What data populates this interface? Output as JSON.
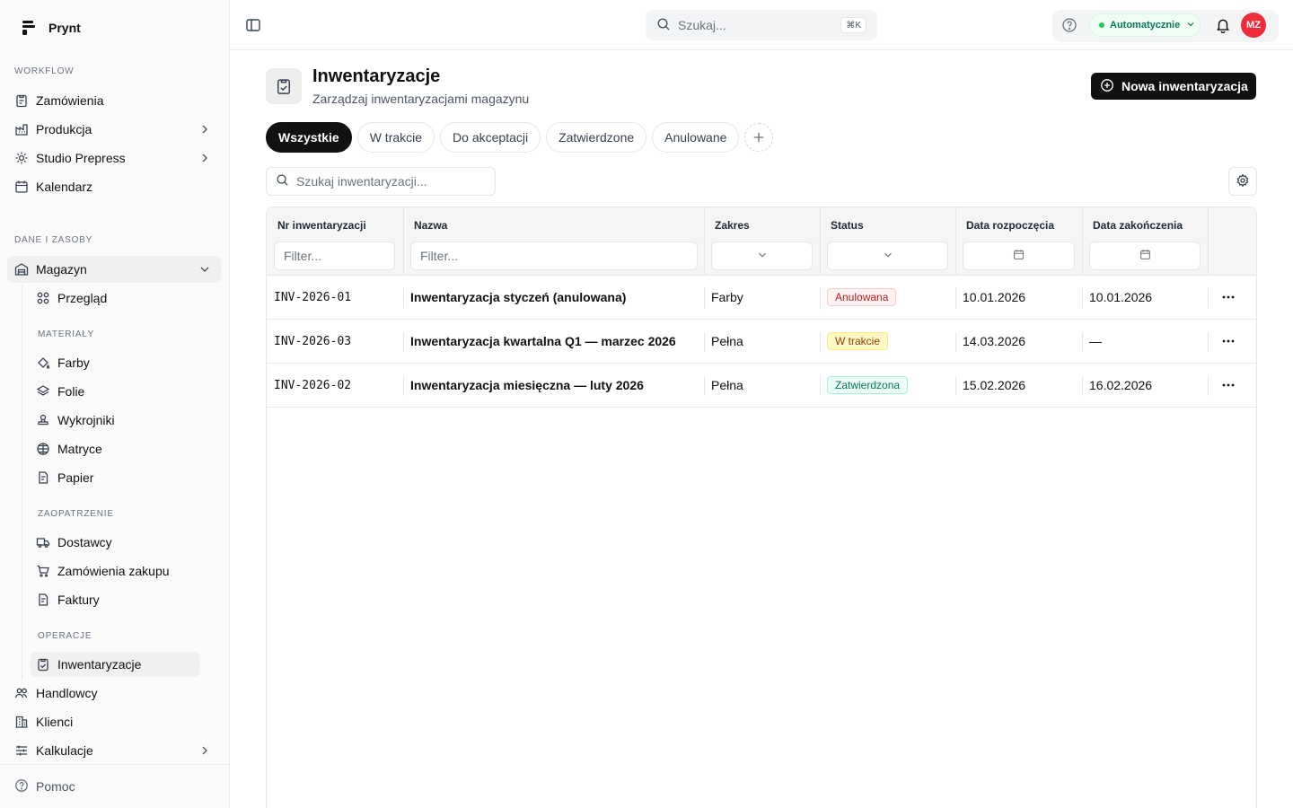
{
  "app": {
    "name": "Prynt"
  },
  "sidebar": {
    "workflow_label": "WORKFLOW",
    "workflow": [
      {
        "label": "Zamówienia",
        "icon": "clipboard-icon"
      },
      {
        "label": "Produkcja",
        "icon": "factory-icon",
        "has_children": true
      },
      {
        "label": "Studio Prepress",
        "icon": "sparkle-icon",
        "has_children": true
      },
      {
        "label": "Kalendarz",
        "icon": "calendar-icon"
      }
    ],
    "resources_label": "DANE I ZASOBY",
    "magazyn": {
      "label": "Magazyn",
      "expanded": true
    },
    "przeglad": "Przegląd",
    "materials_label": "MATERIAŁY",
    "materials": [
      "Farby",
      "Folie",
      "Wykrojniki",
      "Matryce",
      "Papier"
    ],
    "supply_label": "ZAOPATRZENIE",
    "supply": [
      "Dostawcy",
      "Zamówienia zakupu",
      "Faktury"
    ],
    "ops_label": "OPERACJE",
    "ops": [
      "Inwentaryzacje"
    ],
    "bottom": [
      {
        "label": "Handlowcy"
      },
      {
        "label": "Klienci"
      },
      {
        "label": "Kalkulacje",
        "has_children": true
      }
    ],
    "help": "Pomoc"
  },
  "topbar": {
    "search_placeholder": "Szukaj...",
    "shortcut": "⌘K",
    "status": "Automatycznie",
    "avatar_initials": "MZ"
  },
  "page": {
    "title": "Inwentaryzacje",
    "subtitle": "Zarządzaj inwentaryzacjami magazynu",
    "new_button": "Nowa inwentaryzacja",
    "tabs": [
      "Wszystkie",
      "W trakcie",
      "Do akceptacji",
      "Zatwierdzone",
      "Anulowane"
    ],
    "active_tab": "Wszystkie",
    "table_search_placeholder": "Szukaj inwentaryzacji..."
  },
  "table": {
    "columns": [
      "Nr inwentaryzacji",
      "Nazwa",
      "Zakres",
      "Status",
      "Data rozpoczęcia",
      "Data zakończenia"
    ],
    "filter_placeholder": "Filter...",
    "rows": [
      {
        "nr": "INV-2026-01",
        "name": "Inwentaryzacja styczeń (anulowana)",
        "scope": "Farby",
        "status": "Anulowana",
        "status_color": "#b91c1c",
        "start": "10.01.2026",
        "end": "10.01.2026"
      },
      {
        "nr": "INV-2026-03",
        "name": "Inwentaryzacja kwartalna Q1 — marzec 2026",
        "scope": "Pełna",
        "status": "W trakcie",
        "status_color": "#92400e",
        "start": "14.03.2026",
        "end": "—"
      },
      {
        "nr": "INV-2026-02",
        "name": "Inwentaryzacja miesięczna — luty 2026",
        "scope": "Pełna",
        "status": "Zatwierdzona",
        "status_color": "#047857",
        "start": "15.02.2026",
        "end": "16.02.2026"
      }
    ]
  }
}
